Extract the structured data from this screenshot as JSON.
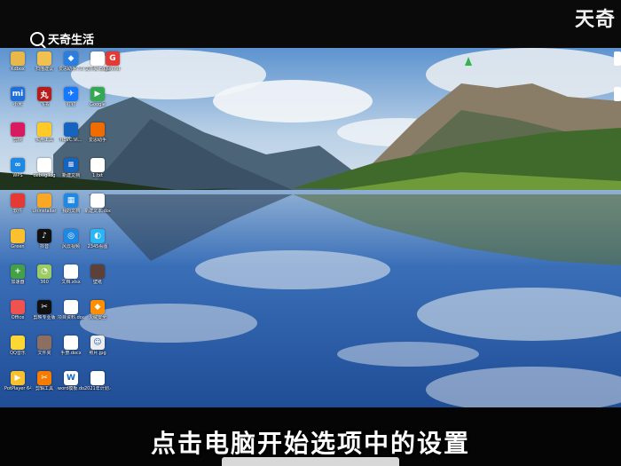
{
  "watermark": {
    "brand": "天奇生活",
    "corner": "天奇"
  },
  "subtitle": "点击电脑开始选项中的设置",
  "desktop_icons": [
    {
      "label": "Kdbox",
      "color": "#e8b84a",
      "text": ""
    },
    {
      "label": "扫描建议",
      "color": "#f0c050",
      "text": ""
    },
    {
      "label": "爱思助手7.0",
      "color": "#2a7de1",
      "text": "◆"
    },
    {
      "label": "文件夹 Edge",
      "color": "#ffffff",
      "text": ""
    },
    {
      "label": "Xmind",
      "color": "#e53935",
      "text": "G"
    },
    {
      "label": "小米",
      "color": "#1e6fd9",
      "text": "mi"
    },
    {
      "label": "飞书",
      "color": "#b71c1c",
      "text": "丸"
    },
    {
      "label": "钉钉",
      "color": "#1677ff",
      "text": "✈"
    },
    {
      "label": "Google",
      "color": "#34a853",
      "text": "▶"
    },
    {
      "label": "剪映",
      "color": "#d81b60",
      "text": ""
    },
    {
      "label": "实用工具",
      "color": "#ffca28",
      "text": ""
    },
    {
      "label": "HEVC.Vi...",
      "color": "#1565c0",
      "text": ""
    },
    {
      "label": "爱思助手",
      "color": "#ef6c00",
      "text": ""
    },
    {
      "label": "WPS",
      "color": "#1e88e5",
      "text": "∞"
    },
    {
      "label": "debug.log",
      "color": "#ffffff",
      "text": ""
    },
    {
      "label": "新建文档",
      "color": "#1565c0",
      "text": "≡"
    },
    {
      "label": "1.txt",
      "color": "#ffffff",
      "text": ""
    },
    {
      "label": "软件",
      "color": "#e53935",
      "text": ""
    },
    {
      "label": "Uninstaller",
      "color": "#f9a825",
      "text": ""
    },
    {
      "label": "我的文档",
      "color": "#1e88e5",
      "text": "▦"
    },
    {
      "label": "新建文本.docx",
      "color": "#ffffff",
      "text": ""
    },
    {
      "label": "Green",
      "color": "#fbc02d",
      "text": ""
    },
    {
      "label": "抖音",
      "color": "#111111",
      "text": "♪"
    },
    {
      "label": "风云视频",
      "color": "#1e88e5",
      "text": "◎"
    },
    {
      "label": "2345看图",
      "color": "#29b6f6",
      "text": "◐"
    },
    {
      "label": "加速器",
      "color": "#43a047",
      "text": "+"
    },
    {
      "label": "360",
      "color": "#9ccc65",
      "text": "◔"
    },
    {
      "label": "文档.xlsx",
      "color": "#ffffff",
      "text": ""
    },
    {
      "label": "壁纸",
      "color": "#5d4037",
      "text": ""
    },
    {
      "label": "Office",
      "color": "#ef5350",
      "text": ""
    },
    {
      "label": "剪映专业版",
      "color": "#111111",
      "text": "✂"
    },
    {
      "label": "项目资料.docx",
      "color": "#ffffff",
      "text": ""
    },
    {
      "label": "火绒安全",
      "color": "#ff8f00",
      "text": "◆"
    },
    {
      "label": "QQ音乐",
      "color": "#fdd835",
      "text": ""
    },
    {
      "label": "文件夹",
      "color": "#8d6e63",
      "text": ""
    },
    {
      "label": "手册.docx",
      "color": "#ffffff",
      "text": ""
    },
    {
      "label": "照片.jpg",
      "color": "#eeeeee",
      "text": "☺"
    },
    {
      "label": "PotPlayer 64 bit",
      "color": "#fbc02d",
      "text": "▶"
    },
    {
      "label": "剪辑工具",
      "color": "#f57c00",
      "text": "✂"
    },
    {
      "label": "word模板.docx",
      "color": "#ffffff",
      "text": "W"
    },
    {
      "label": "2021年计划.docx",
      "color": "#ffffff",
      "text": ""
    }
  ],
  "colors": {
    "sky_top": "#6a9fd6",
    "sky_mid": "#b7cfe6",
    "lake": "#2f63b0",
    "forest": "#2f5a2a",
    "grass": "#6f9a3a"
  }
}
